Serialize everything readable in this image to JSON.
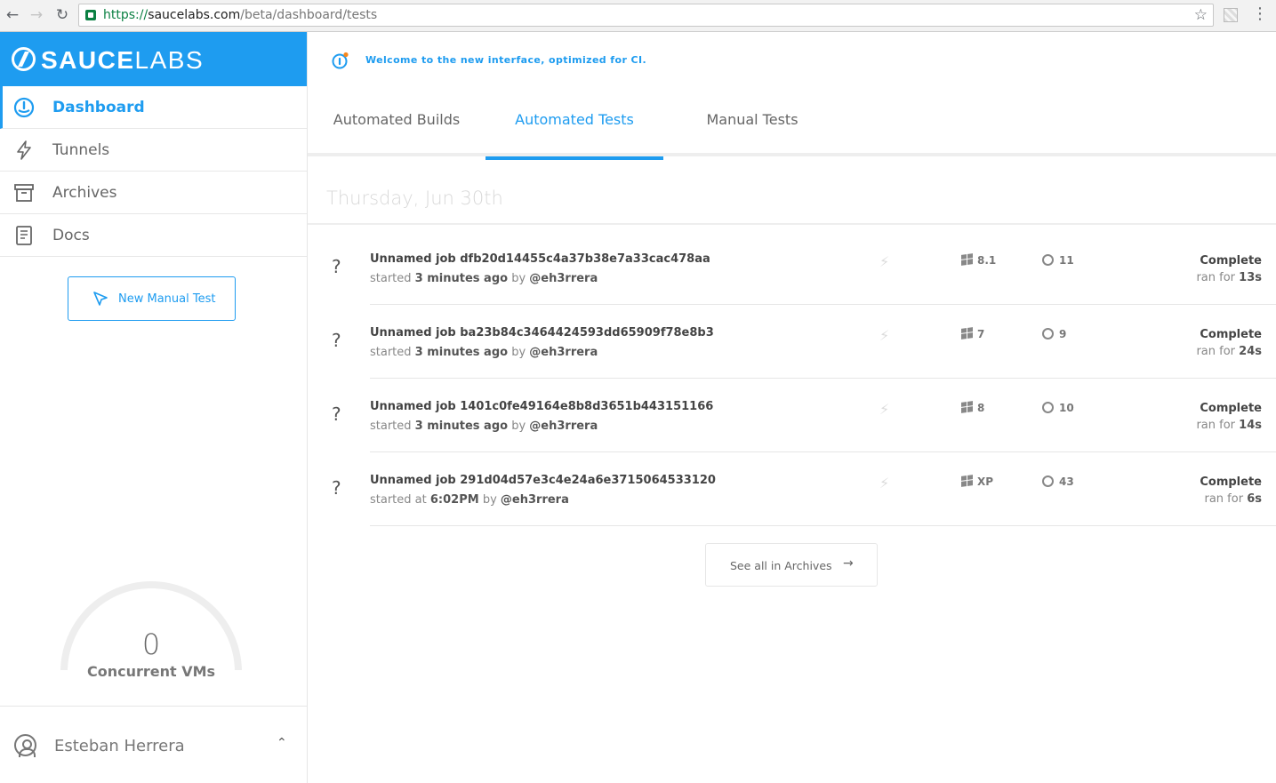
{
  "browser": {
    "url_scheme": "https://",
    "url_host": "saucelabs.com",
    "url_path": "/beta/dashboard/tests",
    "back_icon": "←",
    "forward_icon": "→",
    "reload_icon": "↻",
    "star_icon": "☆",
    "menu_icon": "⋮"
  },
  "brand": {
    "name_bold": "SAUCE",
    "name_light": "LABS",
    "color": "#1e9cf0"
  },
  "sidebar": {
    "items": [
      {
        "label": "Dashboard",
        "icon": "dashboard-icon",
        "active": true
      },
      {
        "label": "Tunnels",
        "icon": "bolt-icon",
        "active": false
      },
      {
        "label": "Archives",
        "icon": "archive-icon",
        "active": false
      },
      {
        "label": "Docs",
        "icon": "book-icon",
        "active": false
      }
    ],
    "new_manual_test": "New Manual Test",
    "concurrent": {
      "value": "0",
      "label": "Concurrent VMs"
    },
    "user": {
      "name": "Esteban Herrera",
      "chevron": "⌃"
    }
  },
  "banner": {
    "text": "Welcome to the new interface, optimized for CI."
  },
  "tabs": [
    {
      "label": "Automated Builds",
      "active": false
    },
    {
      "label": "Automated Tests",
      "active": true
    },
    {
      "label": "Manual Tests",
      "active": false
    }
  ],
  "date_heading": "Thursday, Jun 30th",
  "jobs": [
    {
      "status": "?",
      "title": "Unnamed job dfb20d14455c4a37b38e7a33cac478aa",
      "started_prefix": "started",
      "started_value": "3 minutes ago",
      "by": "by",
      "user": "@eh3rrera",
      "os": "8.1",
      "browser": "11",
      "browser_icon": "ie-icon",
      "result": "Complete",
      "ran_prefix": "ran for",
      "ran_value": "13s"
    },
    {
      "status": "?",
      "title": "Unnamed job ba23b84c3464424593dd65909f78e8b3",
      "started_prefix": "started",
      "started_value": "3 minutes ago",
      "by": "by",
      "user": "@eh3rrera",
      "os": "7",
      "browser": "9",
      "browser_icon": "ie-icon",
      "result": "Complete",
      "ran_prefix": "ran for",
      "ran_value": "24s"
    },
    {
      "status": "?",
      "title": "Unnamed job 1401c0fe49164e8b8d3651b443151166",
      "started_prefix": "started",
      "started_value": "3 minutes ago",
      "by": "by",
      "user": "@eh3rrera",
      "os": "8",
      "browser": "10",
      "browser_icon": "ie-icon",
      "result": "Complete",
      "ran_prefix": "ran for",
      "ran_value": "14s"
    },
    {
      "status": "?",
      "title": "Unnamed job 291d04d57e3c4e24a6e3715064533120",
      "started_prefix": "started at",
      "started_value": "6:02PM",
      "by": "by",
      "user": "@eh3rrera",
      "os": "XP",
      "browser": "43",
      "browser_icon": "chrome-icon",
      "result": "Complete",
      "ran_prefix": "ran for",
      "ran_value": "6s"
    }
  ],
  "see_all": {
    "label": "See all in Archives",
    "arrow": "→"
  }
}
